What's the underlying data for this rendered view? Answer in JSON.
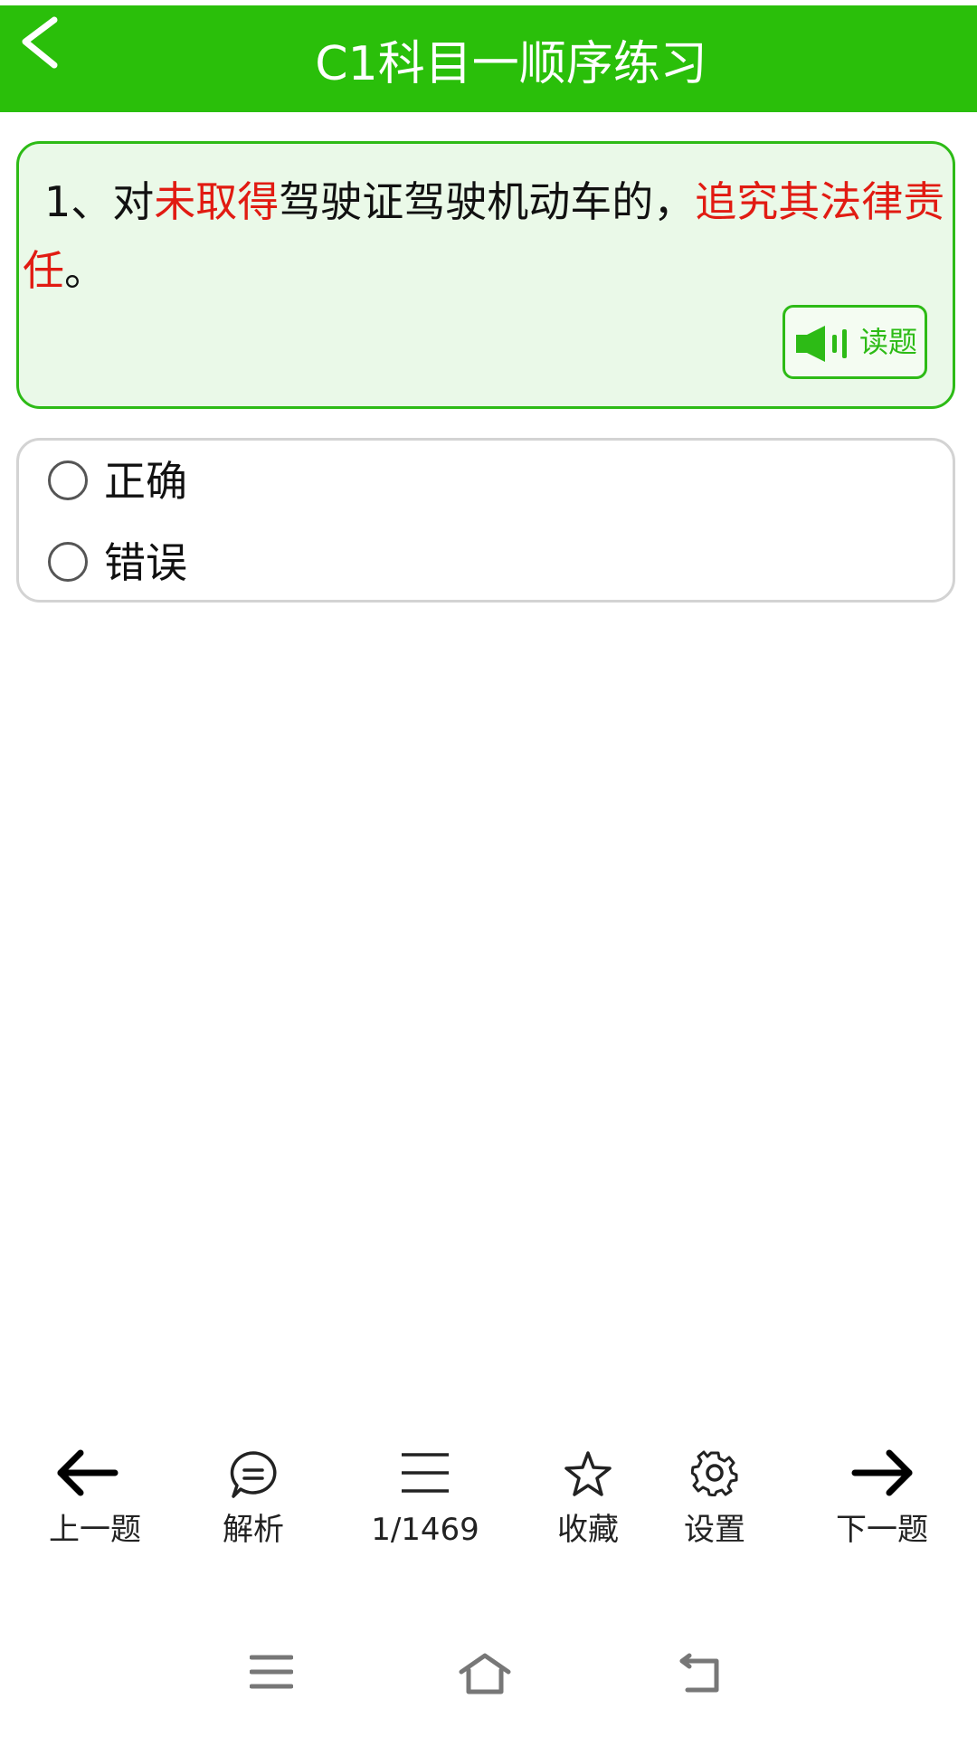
{
  "header": {
    "title": "C1科目一顺序练习",
    "back_icon": "chevron-left-icon",
    "background_color": "#2ABF0A"
  },
  "question": {
    "prefix": "1、对",
    "highlight1": "未取得",
    "middle": "驾驶证驾驶机动车的，",
    "highlight2": "追究其法律责任",
    "suffix": "。",
    "highlight_color": "#E11B12",
    "read_button_label": "读题",
    "read_icon": "speaker-icon"
  },
  "options": [
    {
      "label": "正确",
      "selected": false
    },
    {
      "label": "错误",
      "selected": false
    }
  ],
  "toolbar": {
    "prev_label": "上一题",
    "analysis_label": "解析",
    "progress_label": "1/1469",
    "favorite_label": "收藏",
    "settings_label": "设置",
    "next_label": "下一题"
  },
  "system_nav": {
    "menu_icon": "menu-icon",
    "home_icon": "home-icon",
    "back_icon": "back-icon"
  }
}
